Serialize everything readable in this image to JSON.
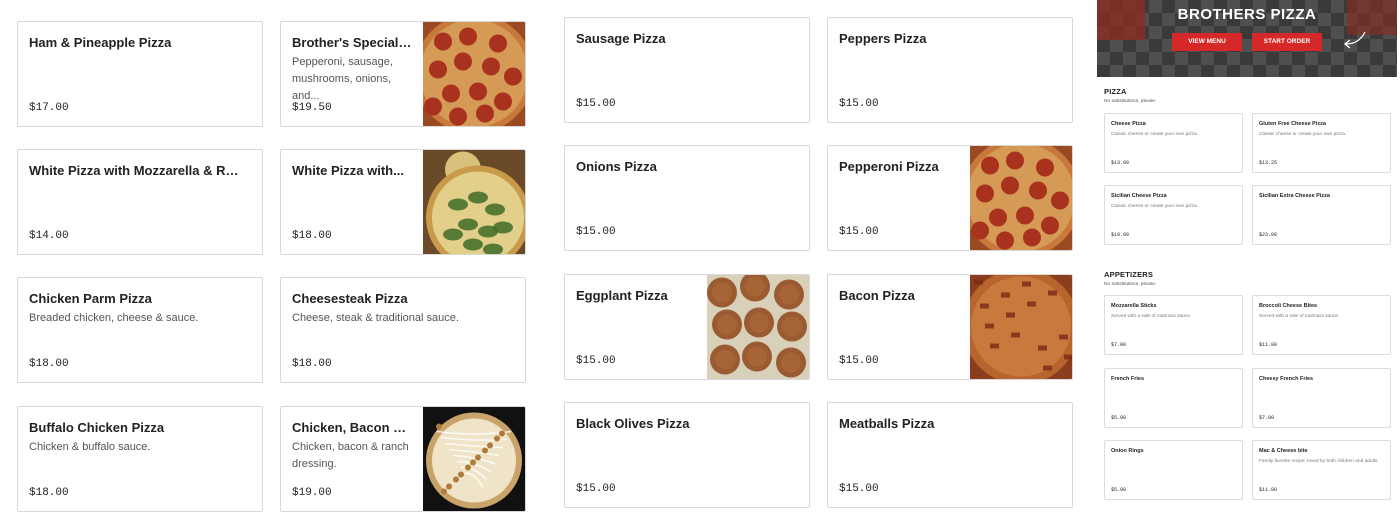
{
  "menu_cards": [
    {
      "name": "Ham & Pineapple Pizza",
      "desc": "",
      "price": "$17.00",
      "photo": ""
    },
    {
      "name": "Brother's Special Pizza",
      "desc": "Pepperoni, sausage, mushrooms, onions, and...",
      "price": "$19.50",
      "photo": "pepperoni-pizza-photo"
    },
    {
      "name": "Sausage Pizza",
      "desc": "",
      "price": "$15.00",
      "photo": ""
    },
    {
      "name": "Peppers Pizza",
      "desc": "",
      "price": "$15.00",
      "photo": ""
    },
    {
      "name": "White Pizza with Mozzarella & Ricotta...",
      "desc": "",
      "price": "$14.00",
      "photo": ""
    },
    {
      "name": "White Pizza with...",
      "desc": "",
      "price": "$18.00",
      "photo": "spinach-pizza-photo"
    },
    {
      "name": "Onions Pizza",
      "desc": "",
      "price": "$15.00",
      "photo": ""
    },
    {
      "name": "Pepperoni Pizza",
      "desc": "",
      "price": "$15.00",
      "photo": "pepperoni-pizza-photo"
    },
    {
      "name": "Chicken Parm Pizza",
      "desc": "Breaded chicken, cheese & sauce.",
      "price": "$18.00",
      "photo": ""
    },
    {
      "name": "Cheesesteak Pizza",
      "desc": "Cheese, steak & traditional sauce.",
      "price": "$18.00",
      "photo": ""
    },
    {
      "name": "Eggplant Pizza",
      "desc": "",
      "price": "$15.00",
      "photo": "eggplant-pizza-photo"
    },
    {
      "name": "Bacon Pizza",
      "desc": "",
      "price": "$15.00",
      "photo": "bacon-pizza-photo"
    },
    {
      "name": "Buffalo Chicken Pizza",
      "desc": "Chicken & buffalo sauce.",
      "price": "$18.00",
      "photo": ""
    },
    {
      "name": "Chicken, Bacon &...",
      "desc": "Chicken, bacon & ranch dressing.",
      "price": "$19.00",
      "photo": "ranch-pizza-photo"
    },
    {
      "name": "Black Olives Pizza",
      "desc": "",
      "price": "$15.00",
      "photo": ""
    },
    {
      "name": "Meatballs Pizza",
      "desc": "",
      "price": "$15.00",
      "photo": ""
    }
  ],
  "preview": {
    "banner_title": "BROTHERS PIZZA",
    "view_menu": "VIEW MENU",
    "start_order": "START ORDER",
    "pizza_section": {
      "title": "PIZZA",
      "subtitle": "No substitutions, please."
    },
    "appetizers_section": {
      "title": "APPETIZERS",
      "subtitle": "No substitutions, please."
    },
    "pizza_items": [
      {
        "name": "Cheese Pizza",
        "desc": "Classic cheese or create your own pizza.",
        "price": "$13.00"
      },
      {
        "name": "Gluten Free Cheese Pizza",
        "desc": "Classic cheese or create your own pizza.",
        "price": "$13.25"
      },
      {
        "name": "Sicilian Cheese Pizza",
        "desc": "Classic cheese or create your own pizza.",
        "price": "$19.00"
      },
      {
        "name": "Sicilian Extra Cheese Pizza",
        "desc": "",
        "price": "$23.00"
      }
    ],
    "appetizer_items": [
      {
        "name": "Mozzarella Sticks",
        "desc": "Served with a side of marinara sauce.",
        "price": "$7.00"
      },
      {
        "name": "Broccoli Cheese Bites",
        "desc": "Served with a side of marinara sauce.",
        "price": "$11.00"
      },
      {
        "name": "French Fries",
        "desc": "",
        "price": "$5.00"
      },
      {
        "name": "Cheesy French Fries",
        "desc": "",
        "price": "$7.00"
      },
      {
        "name": "Onion Rings",
        "desc": "",
        "price": "$5.00"
      },
      {
        "name": "Mac & Cheese bite",
        "desc": "Family favorite recipe, loved by both children and adults.",
        "price": "$11.00"
      }
    ]
  },
  "colors": {
    "accent_red": "#d62828",
    "border": "#d8d8d8"
  }
}
